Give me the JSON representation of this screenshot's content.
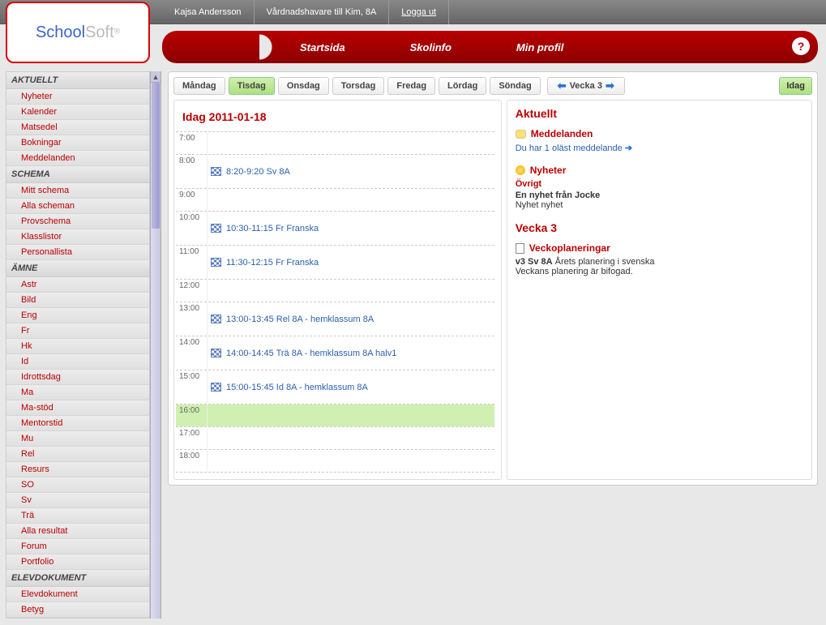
{
  "topbar": {
    "user": "Kajsa Andersson",
    "role": "Vårdnadshavare till Kim, 8A",
    "logout": "Logga ut"
  },
  "logo": {
    "part1": "School",
    "part2": "Soft",
    "reg": "®"
  },
  "nav": {
    "items": [
      "Startsida",
      "Skolinfo",
      "Min profil"
    ],
    "help": "?"
  },
  "sidebar": {
    "sections": [
      {
        "title": "AKTUELLT",
        "items": [
          "Nyheter",
          "Kalender",
          "Matsedel",
          "Bokningar",
          "Meddelanden"
        ]
      },
      {
        "title": "SCHEMA",
        "items": [
          "Mitt schema",
          "Alla scheman",
          "Provschema",
          "Klasslistor",
          "Personallista"
        ]
      },
      {
        "title": "ÄMNE",
        "items": [
          "Astr",
          "Bild",
          "Eng",
          "Fr",
          "Hk",
          "Id",
          "Idrottsdag",
          "Ma",
          "Ma-stöd",
          "Mentorstid",
          "Mu",
          "Rel",
          "Resurs",
          "SO",
          "Sv",
          "Trä",
          "Alla resultat",
          "Forum",
          "Portfolio"
        ]
      },
      {
        "title": "ELEVDOKUMENT",
        "items": [
          "Elevdokument",
          "Betyg"
        ]
      }
    ]
  },
  "daytabs": {
    "days": [
      "Måndag",
      "Tisdag",
      "Onsdag",
      "Torsdag",
      "Fredag",
      "Lördag",
      "Söndag"
    ],
    "active": 1,
    "week": "Vecka 3",
    "today": "Idag"
  },
  "schedule": {
    "title": "Idag 2011-01-18",
    "hours": [
      "7:00",
      "8:00",
      "9:00",
      "10:00",
      "11:00",
      "12:00",
      "13:00",
      "14:00",
      "15:00",
      "16:00",
      "17:00",
      "18:00"
    ],
    "current": "16:00",
    "slots": {
      "8:00": "8:20-9:20 Sv 8A",
      "10:00": "10:30-11:15 Fr Franska",
      "11:00": "11:30-12:15 Fr Franska",
      "13:00": "13:00-13:45 Rel 8A - hemklassum 8A",
      "14:00": "14:00-14:45 Trä 8A - hemklassum 8A halv1",
      "15:00": "15:00-15:45 Id 8A - hemklassum 8A"
    }
  },
  "aktuellt": {
    "title": "Aktuellt",
    "meddelanden": {
      "label": "Meddelanden",
      "text": "Du har 1 oläst meddelande"
    },
    "nyheter": {
      "label": "Nyheter",
      "sub": "Övrigt",
      "headline": "En nyhet från Jocke",
      "body": "Nyhet nyhet"
    },
    "vecka": {
      "label": "Vecka 3",
      "planering": {
        "label": "Veckoplaneringar",
        "line1a": "v3 Sv 8A",
        "line1b": " Årets planering i svenska",
        "line2": "Veckans planering är bifogad."
      }
    }
  }
}
